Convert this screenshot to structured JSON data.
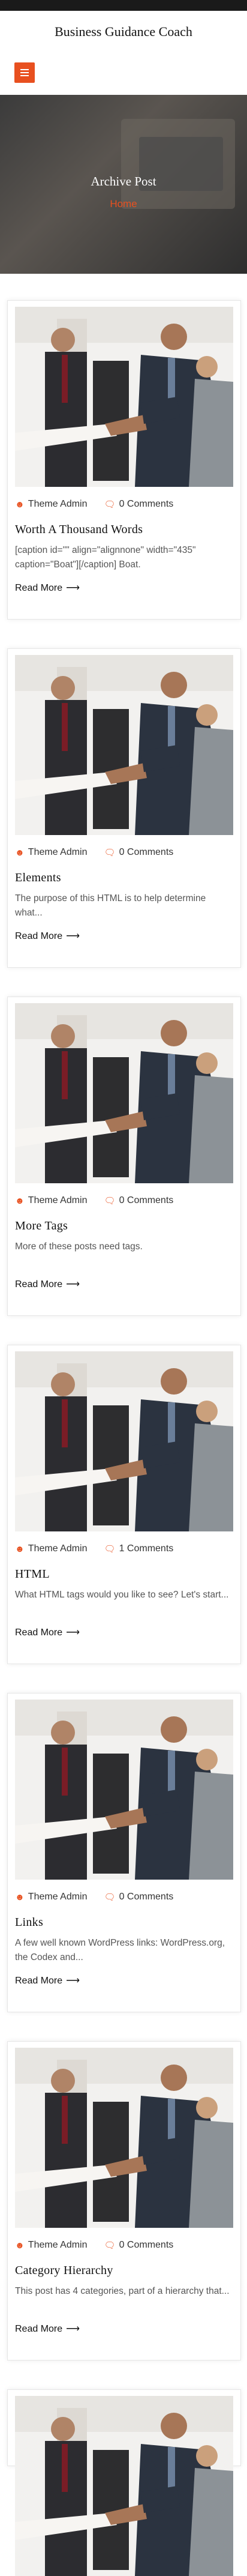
{
  "site": {
    "title": "Business Guidance Coach"
  },
  "hero": {
    "title": "Archive Post",
    "breadcrumb": "Home"
  },
  "colors": {
    "accent": "#e8501f",
    "topbar": "#1a1a1a"
  },
  "icons": {
    "author": "user-icon",
    "comments": "comment-icon",
    "arrow": "arrow-right-icon",
    "menu": "hamburger-menu-icon"
  },
  "posts": [
    {
      "author": "Theme Admin",
      "comments": "0 Comments",
      "title": "Worth A Thousand Words",
      "excerpt": "[caption id=\"\" align=\"alignnone\" width=\"435\" caption=\"Boat\"][/caption] Boat.",
      "read_more": "Read More"
    },
    {
      "author": "Theme Admin",
      "comments": "0 Comments",
      "title": "Elements",
      "excerpt": "The purpose of this HTML is to help determine what...",
      "read_more": "Read More"
    },
    {
      "author": "Theme Admin",
      "comments": "0 Comments",
      "title": "More Tags",
      "excerpt": "More of these posts need tags.",
      "read_more": "Read More"
    },
    {
      "author": "Theme Admin",
      "comments": "1 Comments",
      "title": "HTML",
      "excerpt": "What HTML tags would you like to see? Let's start...",
      "read_more": "Read More"
    },
    {
      "author": "Theme Admin",
      "comments": "0 Comments",
      "title": "Links",
      "excerpt": "A few well known WordPress links: WordPress.org, the Codex and...",
      "read_more": "Read More"
    },
    {
      "author": "Theme Admin",
      "comments": "0 Comments",
      "title": "Category Hierarchy",
      "excerpt": "This post has 4 categories, part of a hierarchy that...",
      "read_more": "Read More"
    }
  ]
}
